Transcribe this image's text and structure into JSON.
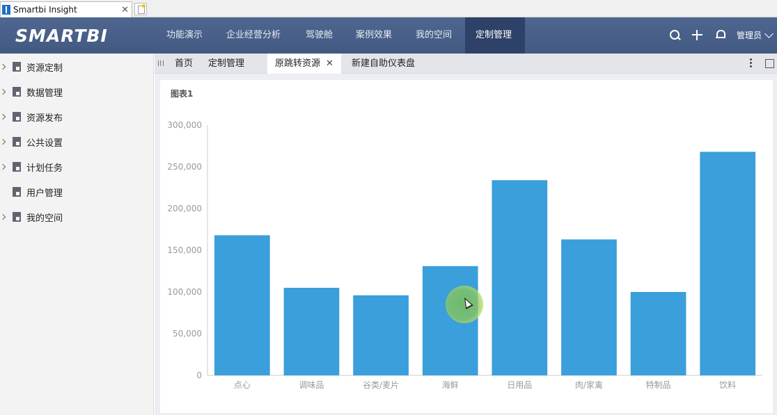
{
  "browser": {
    "tab_title": "Smartbi Insight",
    "close_glyph": "✕"
  },
  "topnav": {
    "logo": "SMARTBI",
    "items": [
      "功能演示",
      "企业经营分析",
      "驾驶舱",
      "案例效果",
      "我的空间",
      "定制管理"
    ],
    "active_item": "定制管理",
    "user_label": "管理员",
    "icons": [
      "search-icon",
      "plus-icon",
      "bell-icon",
      "chevron-down-icon"
    ]
  },
  "sidebar": {
    "items": [
      {
        "label": "资源定制",
        "icon": "resource-custom-icon",
        "expandable": true
      },
      {
        "label": "数据管理",
        "icon": "data-manage-icon",
        "expandable": true
      },
      {
        "label": "资源发布",
        "icon": "resource-publish-icon",
        "expandable": true
      },
      {
        "label": "公共设置",
        "icon": "public-settings-icon",
        "expandable": true
      },
      {
        "label": "计划任务",
        "icon": "scheduled-task-icon",
        "expandable": true
      },
      {
        "label": "用户管理",
        "icon": "user-manage-icon",
        "expandable": false
      },
      {
        "label": "我的空间",
        "icon": "my-space-icon",
        "expandable": true
      }
    ]
  },
  "tabs": {
    "items": [
      "首页",
      "定制管理",
      "原跳转资源",
      "新建自助仪表盘"
    ],
    "active": "原跳转资源",
    "close_glyph": "✕"
  },
  "panel": {
    "title": "图表1"
  },
  "chart_data": {
    "type": "bar",
    "title": "图表1",
    "categories": [
      "点心",
      "调味品",
      "谷类/麦片",
      "海鲜",
      "日用品",
      "肉/家禽",
      "特制品",
      "饮料"
    ],
    "values": [
      168000,
      105000,
      96000,
      131000,
      234000,
      163000,
      100000,
      268000
    ],
    "ylim": [
      0,
      300000
    ],
    "yticks": [
      "0",
      "50,000",
      "100,000",
      "150,000",
      "200,000",
      "250,000",
      "300,000"
    ],
    "xlabel": "",
    "ylabel": "",
    "grid": false,
    "color": "#3a9fda"
  }
}
